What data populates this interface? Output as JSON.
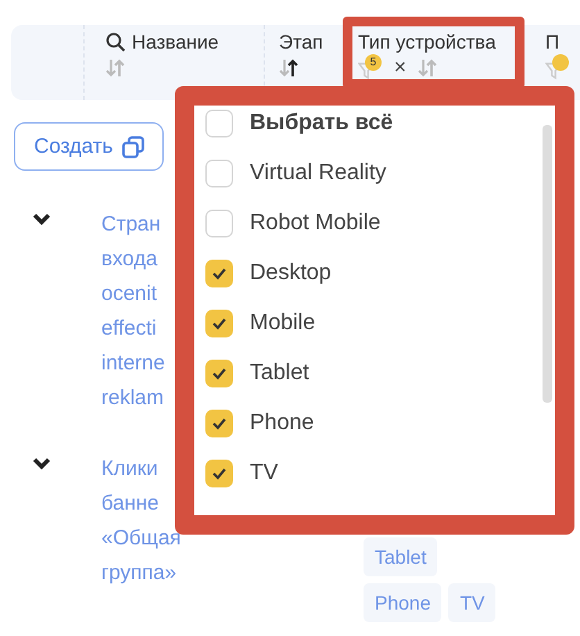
{
  "header": {
    "columns": [
      {
        "label": "Название",
        "kind": "search"
      },
      {
        "label": "Этап",
        "kind": "sort"
      },
      {
        "label": "Тип устройства",
        "kind": "filter",
        "filter_count": "5",
        "clear": "×",
        "highlighted": true
      },
      {
        "label": "П",
        "kind": "filter_cut"
      }
    ]
  },
  "create_button": {
    "label": "Создать"
  },
  "rows": [
    {
      "title": "Стран\nвхода\nocenit\neffecti\ninterne\nreklam",
      "expanded": true,
      "tags": []
    },
    {
      "title": "Клики\nбанне\n«Общая\nгруппа»",
      "expanded": true,
      "tags": [
        "Tablet",
        "Phone",
        "TV"
      ]
    }
  ],
  "dropdown": {
    "highlighted": true,
    "select_all": {
      "label": "Выбрать всё",
      "checked": false
    },
    "options": [
      {
        "label": "Virtual Reality",
        "checked": false
      },
      {
        "label": "Robot Mobile",
        "checked": false
      },
      {
        "label": "Desktop",
        "checked": true
      },
      {
        "label": "Mobile",
        "checked": true
      },
      {
        "label": "Tablet",
        "checked": true
      },
      {
        "label": "Phone",
        "checked": true
      },
      {
        "label": "TV",
        "checked": true
      }
    ]
  }
}
